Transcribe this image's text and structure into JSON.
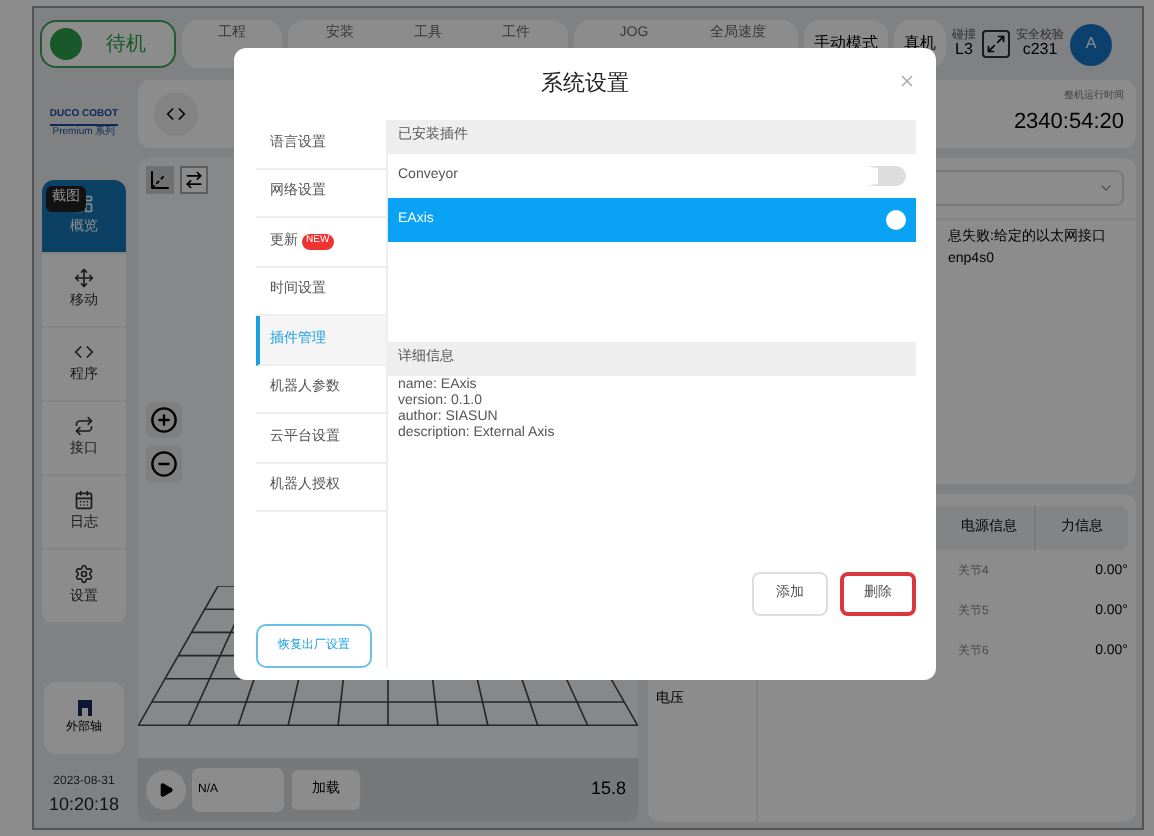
{
  "top_bar": {
    "state": "待机",
    "labels": [
      "工程",
      "安装",
      "工具",
      "工件",
      "JOG",
      "全局速度"
    ],
    "mode": "手动模式",
    "machine": "真机",
    "collision": {
      "label": "碰撞",
      "value": "L3"
    },
    "safety": {
      "label": "安全校验",
      "value": "c231"
    },
    "avatar": "A"
  },
  "sidebar": {
    "logo": "DUCO COBOT",
    "logo_sub": "Premium 系列",
    "tooltip": "截图",
    "items": [
      {
        "label": "概览",
        "kind": "overview",
        "selected": true
      },
      {
        "label": "移动",
        "kind": "move",
        "selected": false
      },
      {
        "label": "程序",
        "kind": "code",
        "selected": false
      },
      {
        "label": "接口",
        "kind": "io",
        "selected": false
      },
      {
        "label": "日志",
        "kind": "log",
        "selected": false
      },
      {
        "label": "设置",
        "kind": "settings",
        "selected": false
      }
    ],
    "external_axis": "外部轴",
    "date": "2023-08-31",
    "time": "10:20:18"
  },
  "program_bar": {
    "name": "N/A",
    "load": "加载",
    "value": "15.8"
  },
  "runtime": {
    "label": "整机运行时间",
    "value": "2340:54:20"
  },
  "message": {
    "line_1": "息失败:给定的以太网接口",
    "line_2": "enp4s0"
  },
  "info_tabs": [
    {
      "label": "电源信息"
    },
    {
      "label": "力信息"
    }
  ],
  "voltage_label": "电压",
  "joints": [
    {
      "name": "关节4",
      "value": "0.00°"
    },
    {
      "name": "关节5",
      "value": "0.00°"
    },
    {
      "name": "关节6",
      "value": "0.00°"
    }
  ],
  "dialog": {
    "title": "系统设置",
    "menu": [
      {
        "label": "语言设置",
        "selected": false
      },
      {
        "label": "网络设置",
        "selected": false
      },
      {
        "label": "更新",
        "badge": "NEW",
        "selected": false
      },
      {
        "label": "时间设置",
        "selected": false
      },
      {
        "label": "插件管理",
        "selected": true
      },
      {
        "label": "机器人参数",
        "selected": false
      },
      {
        "label": "云平台设置",
        "selected": false
      },
      {
        "label": "机器人授权",
        "selected": false
      }
    ],
    "restore_button": "恢复出厂设置",
    "installed_header": "已安装插件",
    "plugins": [
      {
        "name": "Conveyor",
        "on": false,
        "selected": false
      },
      {
        "name": "EAxis",
        "on": true,
        "selected": true
      }
    ],
    "details_header": "详细信息",
    "details": [
      "name: EAxis",
      "version: 0.1.0",
      "author: SIASUN",
      "description: External Axis"
    ],
    "buttons": [
      {
        "label": "添加",
        "highlighted": false
      },
      {
        "label": "删除",
        "highlighted": true
      }
    ]
  }
}
